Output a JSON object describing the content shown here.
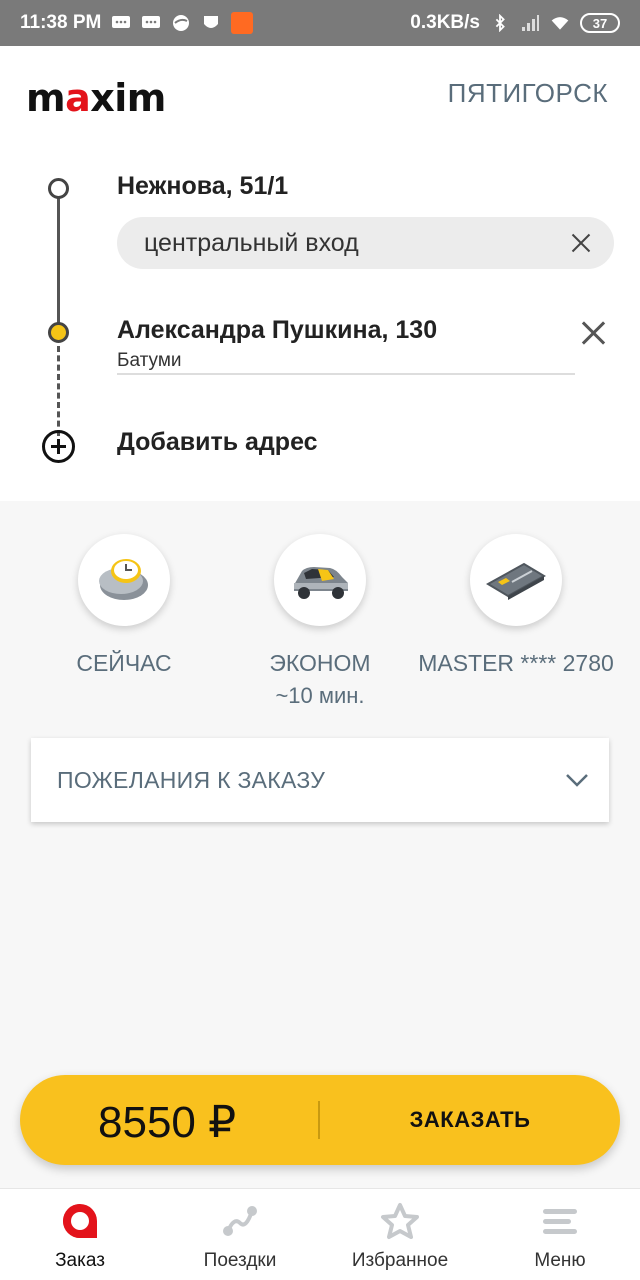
{
  "status_bar": {
    "time": "11:38 PM",
    "network_speed": "0.3KB/s",
    "battery": "37"
  },
  "header": {
    "logo": "maxim",
    "city": "ПЯТИГОРСК"
  },
  "route": {
    "from_address": "Нежнова, 51/1",
    "entrance": "центральный вход",
    "to_address": "Александра Пушкина, 130",
    "to_city": "Батуми",
    "add_address_label": "Добавить адрес"
  },
  "options": {
    "time_label": "СЕЙЧАС",
    "class_label": "ЭКОНОМ",
    "class_eta": "~10 мин.",
    "payment_label": "MASTER **** 2780"
  },
  "wishes": {
    "label": "ПОЖЕЛАНИЯ К ЗАКАЗУ"
  },
  "order": {
    "price": "8550 ₽",
    "button_label": "ЗАКАЗАТЬ"
  },
  "bottom_nav": {
    "items": [
      {
        "label": "Заказ",
        "icon": "order-icon",
        "active": true
      },
      {
        "label": "Поездки",
        "icon": "trips-icon"
      },
      {
        "label": "Избранное",
        "icon": "star-icon"
      },
      {
        "label": "Меню",
        "icon": "menu-icon"
      }
    ]
  },
  "colors": {
    "brand_red": "#e3131b",
    "accent_yellow": "#f9c11e",
    "label_gray_blue": "#5a6d7b"
  }
}
